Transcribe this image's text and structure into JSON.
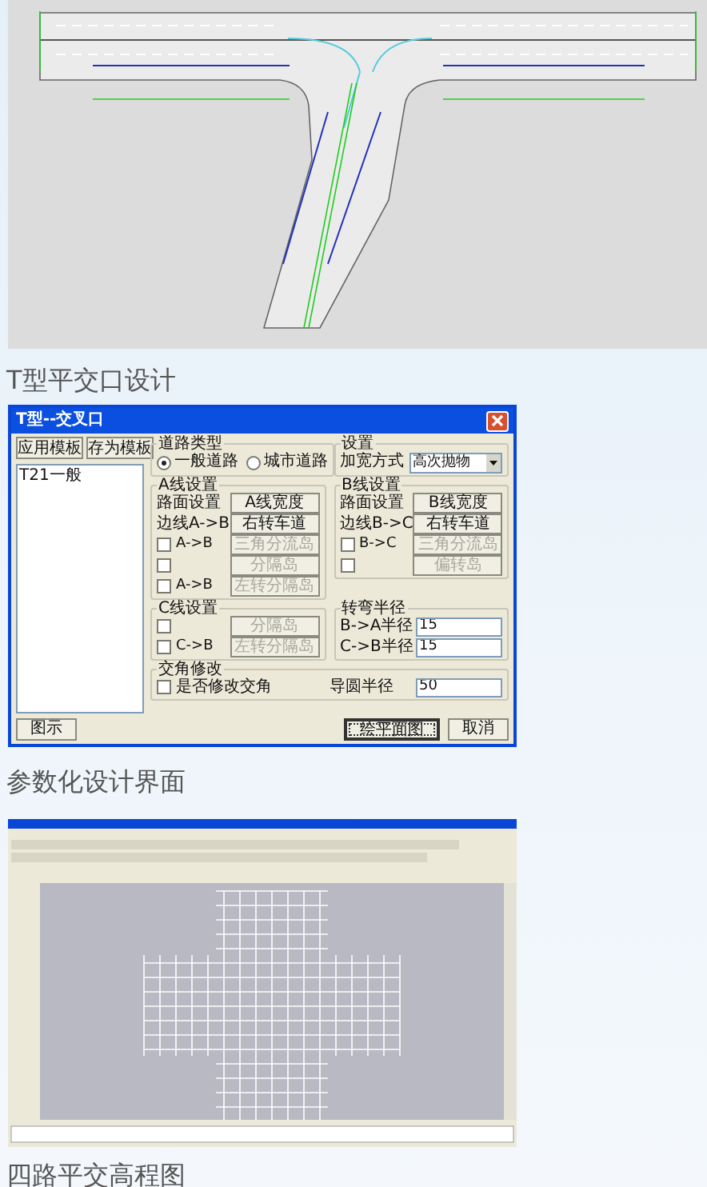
{
  "figures": [
    {
      "kind": "road_drawing",
      "caption": "T型平交口设计"
    },
    {
      "kind": "dialog",
      "caption": "参数化设计界面",
      "dialog": {
        "title": "T型--交叉口",
        "template_buttons": [
          {
            "label": "应用模板"
          },
          {
            "label": "存为模板"
          }
        ],
        "template_list": [
          "T21一般"
        ],
        "road_type": {
          "title": "道路类型",
          "options": [
            {
              "label": "一般道路",
              "selected": true
            },
            {
              "label": "城市道路",
              "selected": false
            }
          ]
        },
        "settings": {
          "title": "设置",
          "label": "加宽方式",
          "value": "高次抛物"
        },
        "line_groups": [
          {
            "title": "A线设置",
            "rows": [
              {
                "kind": "label",
                "label": "路面设置",
                "button": {
                  "label": "A线宽度",
                  "disabled": false
                }
              },
              {
                "kind": "label",
                "label": "边线A->B",
                "button": {
                  "label": "右转车道",
                  "disabled": false
                }
              },
              {
                "kind": "checkbox",
                "label": "A->B",
                "checked": false,
                "button": {
                  "label": "三角分流岛",
                  "disabled": true
                }
              },
              {
                "kind": "checkbox",
                "checked": false,
                "button": {
                  "label": "分隔岛",
                  "disabled": true
                }
              },
              {
                "kind": "checkbox",
                "label": "A->B",
                "checked": false,
                "button": {
                  "label": "左转分隔岛",
                  "disabled": true
                }
              }
            ]
          },
          {
            "title": "B线设置",
            "rows": [
              {
                "kind": "label",
                "label": "路面设置",
                "button": {
                  "label": "B线宽度",
                  "disabled": false
                }
              },
              {
                "kind": "label",
                "label": "边线B->C",
                "button": {
                  "label": "右转车道",
                  "disabled": false
                }
              },
              {
                "kind": "checkbox",
                "label": "B->C",
                "checked": false,
                "button": {
                  "label": "三角分流岛",
                  "disabled": true
                }
              },
              {
                "kind": "checkbox",
                "checked": false,
                "button": {
                  "label": "偏转岛",
                  "disabled": true
                }
              }
            ]
          },
          {
            "title": "C线设置",
            "rows": [
              {
                "kind": "checkbox",
                "checked": false,
                "button": {
                  "label": "分隔岛",
                  "disabled": true
                }
              },
              {
                "kind": "checkbox",
                "label": "C->B",
                "checked": false,
                "button": {
                  "label": "左转分隔岛",
                  "disabled": true
                }
              }
            ]
          }
        ],
        "turn_radius": {
          "title": "转弯半径",
          "fields": [
            {
              "label": "B->A半径",
              "value": "15"
            },
            {
              "label": "C->B半径",
              "value": "15"
            }
          ]
        },
        "angle": {
          "title": "交角修改",
          "checkbox": {
            "label": "是否修改交角",
            "checked": false
          },
          "field": {
            "label": "导圆半径",
            "value": "50"
          }
        },
        "footer_buttons": [
          {
            "label": "图示",
            "default": false
          },
          {
            "label": "绘平面图",
            "default": true
          },
          {
            "label": "取消",
            "default": false
          }
        ]
      }
    },
    {
      "kind": "cad_window",
      "caption": "四路平交高程图"
    }
  ]
}
